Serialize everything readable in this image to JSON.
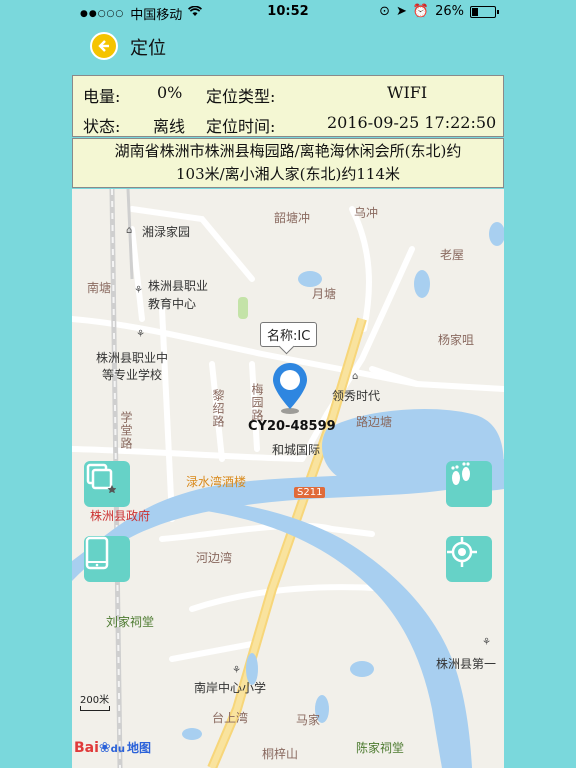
{
  "status_bar": {
    "carrier": "中国移动",
    "time": "10:52",
    "battery_percent": "26%",
    "battery_level": 0.26
  },
  "nav": {
    "title": "定位",
    "back_icon": "back-arrow-icon"
  },
  "info": {
    "power_label": "电量:",
    "power_value": "0%",
    "loc_type_label": "定位类型:",
    "loc_type_value": "WIFI",
    "state_label": "状态:",
    "state_value": "离线",
    "loc_time_label": "定位时间:",
    "loc_time_value": "2016-09-25 17:22:50"
  },
  "address": {
    "line1": "湖南省株洲市株洲县梅园路/离艳海休闲会所(东北)约",
    "line2": "103米/离小湘人家(东北)约114米"
  },
  "map": {
    "popup": "名称:IC",
    "device_id": "CY20-48599",
    "places": {
      "xianglu": "湘渌家园",
      "shaotangchong": "韶塘冲",
      "wuchong": "乌冲",
      "laowu": "老屋",
      "nantang": "南塘",
      "vocational_center": "株洲县职业",
      "vocational_center2": "教育中心",
      "yuetang": "月塘",
      "yangjiazui": "杨家咀",
      "vocational_school": "株洲县职业中",
      "vocational_school2": "等专业学校",
      "lingxiu": "领秀时代",
      "lubiantang": "路边塘",
      "lizhaolu": "黎绍路",
      "meiyuanlu": "梅园路",
      "xuetanglu": "学堂路",
      "hecheng": "和城国际",
      "luwan": "渌水湾酒楼",
      "s211": "S211",
      "county_gov": "株洲县政府",
      "hebianwan": "河边湾",
      "liujia": "刘家祠堂",
      "county_first": "株洲县第一",
      "nanan_school": "南岸中心小学",
      "taishangwan": "台上湾",
      "majia": "马家",
      "chenjia": "陈家祠堂",
      "tongzishan": "桐梓山"
    },
    "scale": "200米",
    "logo_bai": "Bai",
    "logo_du": "du",
    "logo_map": "地图"
  },
  "icons": {
    "layers": "map-layers-icon",
    "phone": "phone-icon",
    "footprint": "footprint-icon",
    "locate": "locate-target-icon"
  }
}
